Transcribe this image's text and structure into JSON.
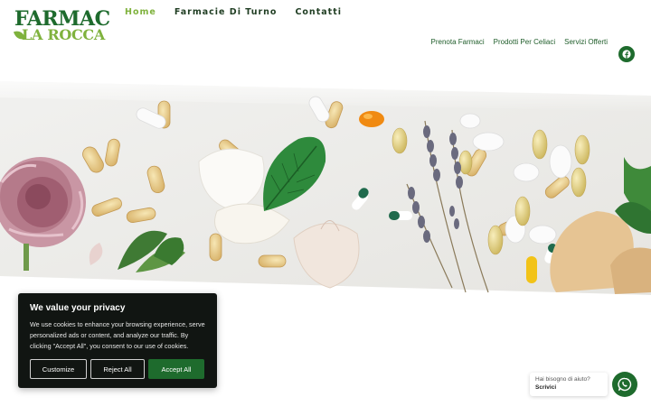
{
  "logo": {
    "line1": "FARMAC",
    "line2": "LA ROCCA"
  },
  "main_nav": [
    {
      "label": "Home"
    },
    {
      "label": "Farmacie Di Turno"
    },
    {
      "label": "Contatti"
    }
  ],
  "sub_nav": [
    {
      "label": "Prenota Farmaci"
    },
    {
      "label": "Prodotti Per Celiaci"
    },
    {
      "label": "Servizi Offerti"
    }
  ],
  "social": {
    "icon": "facebook-icon"
  },
  "cookie_banner": {
    "title": "We value your privacy",
    "text": "We use cookies to enhance your browsing experience, serve personalized ads or content, and analyze our traffic. By clicking \"Accept All\", you consent to our use of cookies.",
    "customize_label": "Customize",
    "reject_label": "Reject All",
    "accept_label": "Accept All"
  },
  "whatsapp": {
    "help_text": "Hai bisogno di aiuto?",
    "action_text": "Scrivici",
    "icon": "whatsapp-icon"
  },
  "colors": {
    "brand_green": "#1e6b2d",
    "accent_green": "#7fb23d",
    "banner_bg": "#111512"
  }
}
